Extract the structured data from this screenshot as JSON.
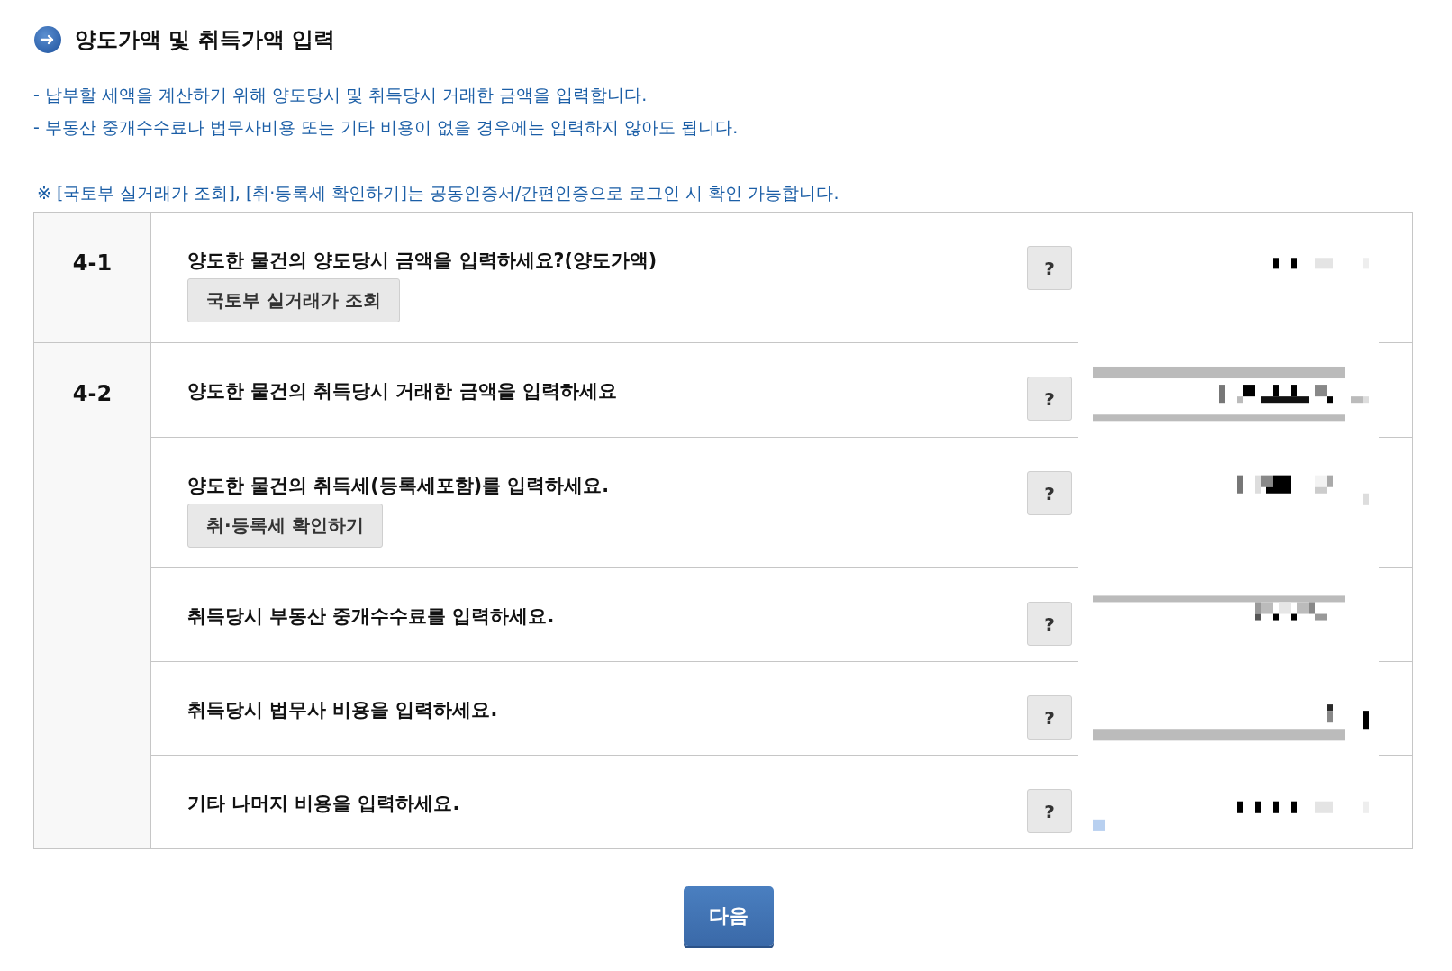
{
  "section": {
    "title": "양도가액 및 취득가액 입력"
  },
  "notes": [
    "- 납부할 세액을 계산하기 위해 양도당시 및 취득당시 거래한 금액을 입력합니다.",
    "- 부동산 중개수수료나 법무사비용 또는 기타 비용이 없을 경우에는 입력하지 않아도 됩니다."
  ],
  "notice": "※ [국토부 실거래가 조회], [취·등록세 확인하기]는 공동인증서/간편인증으로 로그인 시 확인 가능합니다.",
  "table": {
    "groups": [
      {
        "number": "4-1",
        "rows": [
          {
            "question": "양도한 물건의 양도당시 금액을 입력하세요?(양도가액)",
            "button": "국토부 실거래가 조회",
            "help": "?"
          }
        ]
      },
      {
        "number": "4-2",
        "rows": [
          {
            "question": "양도한 물건의 취득당시 거래한 금액을 입력하세요",
            "help": "?"
          },
          {
            "question": "양도한 물건의 취득세(등록세포함)를 입력하세요.",
            "button": "취·등록세 확인하기",
            "help": "?"
          },
          {
            "question": "취득당시 부동산 중개수수료를 입력하세요.",
            "help": "?"
          },
          {
            "question": "취득당시 법무사 비용을 입력하세요.",
            "help": "?"
          },
          {
            "question": "기타 나머지 비용을 입력하세요.",
            "help": "?"
          }
        ]
      }
    ]
  },
  "next_button": "다음"
}
